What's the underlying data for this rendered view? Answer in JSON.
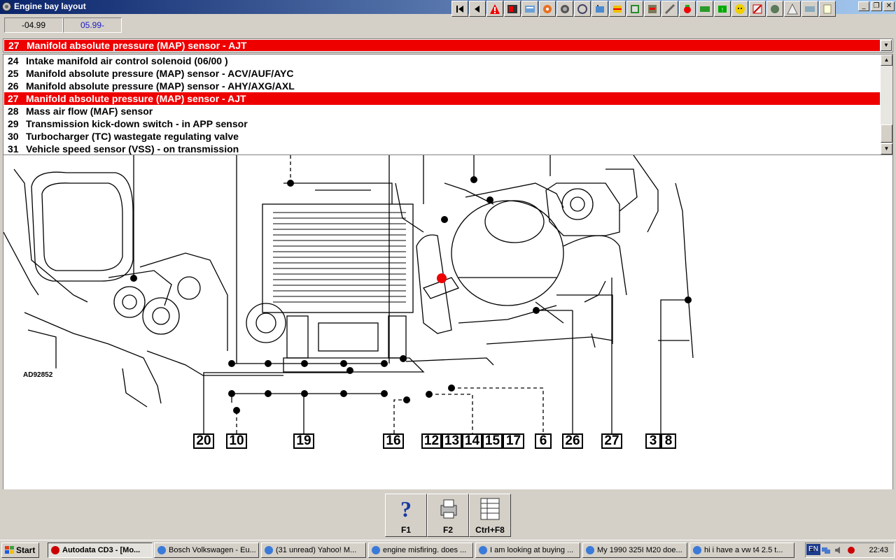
{
  "window": {
    "title": "Engine bay layout"
  },
  "toolbar": {
    "icons": [
      "first-icon",
      "back-icon",
      "warning-icon",
      "contents-icon",
      "service-icon",
      "engine-icon",
      "tyre-icon",
      "repair-icon",
      "battery-icon",
      "manual-icon",
      "engine-bay-icon",
      "spark-icon",
      "wiring-icon",
      "sensor-icon",
      "emission-icon",
      "fault-icon",
      "diagnose-icon",
      "tools-icon",
      "security-icon",
      "options-icon",
      "exit-icon"
    ]
  },
  "dates": {
    "from": "-04.99",
    "to": "05.99-"
  },
  "combo": {
    "num": "27",
    "label": "Manifold absolute pressure (MAP) sensor - AJT"
  },
  "list": [
    {
      "num": "24",
      "label": "Intake manifold air control solenoid (06/00 )"
    },
    {
      "num": "25",
      "label": "Manifold absolute pressure (MAP) sensor - ACV/AUF/AYC"
    },
    {
      "num": "26",
      "label": "Manifold absolute pressure (MAP) sensor - AHY/AXG/AXL"
    },
    {
      "num": "27",
      "label": "Manifold absolute pressure (MAP) sensor - AJT"
    },
    {
      "num": "28",
      "label": "Mass air flow (MAF) sensor"
    },
    {
      "num": "29",
      "label": "Transmission kick-down switch - in APP sensor"
    },
    {
      "num": "30",
      "label": "Turbocharger (TC) wastegate regulating valve"
    },
    {
      "num": "31",
      "label": "Vehicle speed sensor (VSS) - on transmission"
    }
  ],
  "selected_index": 3,
  "diagram": {
    "ref": "AD92852",
    "labels": [
      "20",
      "10",
      "19",
      "16",
      "12",
      "13",
      "14",
      "15",
      "17",
      "6",
      "26",
      "27",
      "3",
      "8"
    ]
  },
  "fkeys": [
    {
      "label": "F1",
      "icon": "help-icon"
    },
    {
      "label": "F2",
      "icon": "print-icon"
    },
    {
      "label": "Ctrl+F8",
      "icon": "table-icon"
    }
  ],
  "taskbar": {
    "start": "Start",
    "tasks": [
      {
        "label": "Autodata CD3 - [Mo...",
        "active": true
      },
      {
        "label": "Bosch Volkswagen - Eu...",
        "active": false
      },
      {
        "label": "(31 unread) Yahoo! M...",
        "active": false
      },
      {
        "label": "engine misfiring. does ...",
        "active": false
      },
      {
        "label": "I am looking at buying ...",
        "active": false
      },
      {
        "label": "My 1990 325I M20 doe...",
        "active": false
      },
      {
        "label": "hi i have a vw t4 2.5 t...",
        "active": false
      }
    ],
    "lang": "EN",
    "clock": "22:43"
  }
}
